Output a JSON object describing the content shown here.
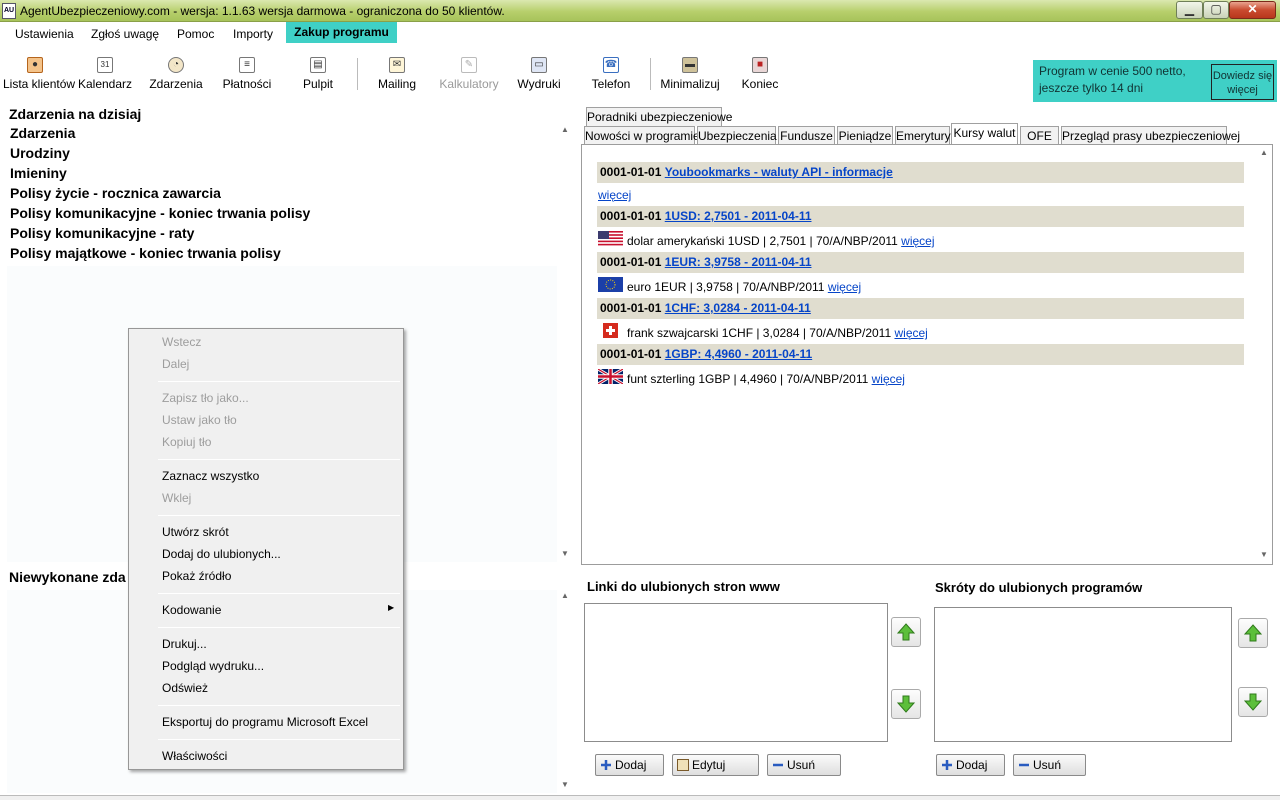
{
  "window": {
    "title": "AgentUbezpieczeniowy.com - wersja: 1.1.63 wersja darmowa - ograniczona do 50 klientów.",
    "app_icon": "AU",
    "controls": {
      "minimize": "▁",
      "maximize": "▢",
      "close": "✕"
    }
  },
  "menu": {
    "items": [
      "Ustawienia",
      "Zgłoś uwagę",
      "Pomoc",
      "Importy",
      "Zakup programu"
    ],
    "highlight_color": "#3fd0c6"
  },
  "toolbar": {
    "buttons": [
      {
        "label": "Lista klientów",
        "icon": "users-icon",
        "enabled": true
      },
      {
        "label": "Kalendarz",
        "icon": "calendar-icon",
        "enabled": true
      },
      {
        "label": "Zdarzenia",
        "icon": "clock-icon",
        "enabled": true
      },
      {
        "label": "Płatności",
        "icon": "document-icon",
        "enabled": true
      },
      {
        "label": "Pulpit",
        "icon": "desktop-icon",
        "enabled": true
      },
      {
        "label": "Mailing",
        "icon": "mail-icon",
        "enabled": true
      },
      {
        "label": "Kalkulatory",
        "icon": "calculator-icon",
        "enabled": false
      },
      {
        "label": "Wydruki",
        "icon": "printer-icon",
        "enabled": true
      },
      {
        "label": "Telefon",
        "icon": "phone-icon",
        "enabled": true
      },
      {
        "label": "Minimalizuj",
        "icon": "minimize-icon",
        "enabled": true
      },
      {
        "label": "Koniec",
        "icon": "exit-icon",
        "enabled": true
      }
    ],
    "icon_glyphs": {
      "calendar-icon": "31"
    }
  },
  "promo": {
    "text": "Program w cenie 500 netto, jeszcze tylko 14 dni",
    "button": "Dowiedz się więcej"
  },
  "left": {
    "heading": "Zdarzenia na dzisiaj",
    "events": [
      "Zdarzenia",
      "Urodziny",
      "Imieniny",
      "Polisy życie - rocznica zawarcia",
      "Polisy komunikacyjne - koniec trwania polisy",
      "Polisy komunikacyjne - raty",
      "Polisy majątkowe - koniec trwania polisy"
    ],
    "undone_heading": "Niewykonane zda"
  },
  "context_menu": {
    "items": [
      {
        "label": "Wstecz",
        "enabled": false
      },
      {
        "label": "Dalej",
        "enabled": false
      },
      {
        "label": "Zapisz tło jako...",
        "enabled": false
      },
      {
        "label": "Ustaw jako tło",
        "enabled": false
      },
      {
        "label": "Kopiuj tło",
        "enabled": false
      },
      {
        "label": "Zaznacz wszystko",
        "enabled": true
      },
      {
        "label": "Wklej",
        "enabled": false
      },
      {
        "label": "Utwórz skrót",
        "enabled": true
      },
      {
        "label": "Dodaj do ulubionych...",
        "enabled": true
      },
      {
        "label": "Pokaż źródło",
        "enabled": true
      },
      {
        "label": "Kodowanie",
        "enabled": true,
        "submenu": true
      },
      {
        "label": "Drukuj...",
        "enabled": true
      },
      {
        "label": "Podgląd wydruku...",
        "enabled": true
      },
      {
        "label": "Odśwież",
        "enabled": true
      },
      {
        "label": "Eksportuj do programu Microsoft Excel",
        "enabled": true
      },
      {
        "label": "Właściwości",
        "enabled": true
      }
    ]
  },
  "tabs": {
    "row1": [
      "Poradniki ubezpieczeniowe"
    ],
    "row2": [
      "Nowości w programie",
      "Ubezpieczenia",
      "Fundusze",
      "Pieniądze",
      "Emerytury",
      "Kursy walut",
      "OFE",
      "Przegląd prasy ubezpieczeniowej"
    ],
    "active": "Kursy walut"
  },
  "rates": {
    "header": {
      "date": "0001-01-01",
      "link": "Youbookmarks - waluty API - informacje",
      "more": "więcej"
    },
    "items": [
      {
        "date": "0001-01-01",
        "link": "1USD: 2,7501 - 2011-04-11",
        "flag": "us-flag-icon",
        "text": "dolar amerykański 1USD | 2,7501 | 70/A/NBP/2011",
        "more": "więcej"
      },
      {
        "date": "0001-01-01",
        "link": "1EUR: 3,9758 - 2011-04-11",
        "flag": "eu-flag-icon",
        "text": "euro 1EUR | 3,9758 | 70/A/NBP/2011",
        "more": "więcej"
      },
      {
        "date": "0001-01-01",
        "link": "1CHF: 3,0284 - 2011-04-11",
        "flag": "ch-flag-icon",
        "text": "frank szwajcarski 1CHF | 3,0284 | 70/A/NBP/2011",
        "more": "więcej"
      },
      {
        "date": "0001-01-01",
        "link": "1GBP: 4,4960 - 2011-04-11",
        "flag": "gb-flag-icon",
        "text": "funt szterling 1GBP | 4,4960 | 70/A/NBP/2011",
        "more": "więcej"
      }
    ]
  },
  "favorites": {
    "links_heading": "Linki do ulubionych stron www",
    "programs_heading": "Skróty do ulubionych programów",
    "add": "Dodaj",
    "edit": "Edytuj",
    "remove": "Usuń"
  }
}
